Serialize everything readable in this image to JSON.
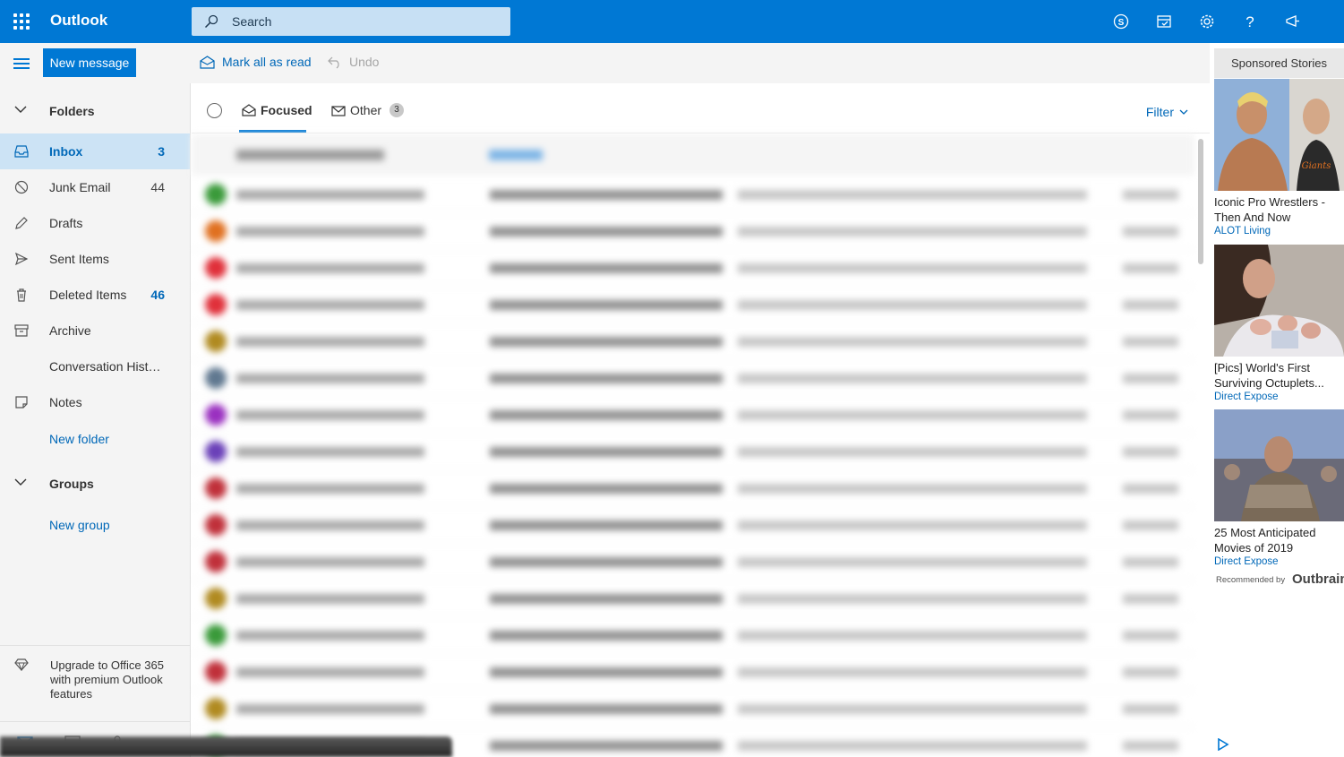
{
  "app": {
    "name": "Outlook"
  },
  "search": {
    "placeholder": "Search"
  },
  "toolbar": {
    "new_message": "New message",
    "mark_all_read": "Mark all as read",
    "undo": "Undo"
  },
  "folders": {
    "heading": "Folders",
    "items": [
      {
        "label": "Inbox",
        "count": "3",
        "icon": "inbox-icon",
        "active": true
      },
      {
        "label": "Junk Email",
        "count": "44",
        "icon": "junk-icon"
      },
      {
        "label": "Drafts",
        "count": "",
        "icon": "pencil-icon"
      },
      {
        "label": "Sent Items",
        "count": "",
        "icon": "send-icon"
      },
      {
        "label": "Deleted Items",
        "count": "46",
        "icon": "trash-icon"
      },
      {
        "label": "Archive",
        "count": "",
        "icon": "archive-icon"
      },
      {
        "label": "Conversation Hist…",
        "count": "",
        "icon": ""
      },
      {
        "label": "Notes",
        "count": "",
        "icon": "note-icon"
      }
    ],
    "new_folder": "New folder"
  },
  "groups": {
    "heading": "Groups",
    "new_group": "New group"
  },
  "upgrade": {
    "text": "Upgrade to Office 365 with premium Outlook features"
  },
  "tabs": {
    "focused": "Focused",
    "other": "Other",
    "other_count": "3",
    "filter": "Filter"
  },
  "message_rows": [
    {
      "avatar_color": "#3a9a3a"
    },
    {
      "avatar_color": "#e07020"
    },
    {
      "avatar_color": "#e0303a"
    },
    {
      "avatar_color": "#e0303a"
    },
    {
      "avatar_color": "#b08a20"
    },
    {
      "avatar_color": "#607890"
    },
    {
      "avatar_color": "#9a30c0"
    },
    {
      "avatar_color": "#6a40b8"
    },
    {
      "avatar_color": "#c0303a"
    },
    {
      "avatar_color": "#c0303a"
    },
    {
      "avatar_color": "#c0303a"
    },
    {
      "avatar_color": "#b08a20"
    },
    {
      "avatar_color": "#3a9a3a"
    },
    {
      "avatar_color": "#c0303a"
    },
    {
      "avatar_color": "#b08a20"
    },
    {
      "avatar_color": "#3a9a3a"
    }
  ],
  "ads": {
    "heading": "Sponsored Stories",
    "items": [
      {
        "title": "Iconic Pro Wrestlers - Then And Now",
        "source": "ALOT Living"
      },
      {
        "title": "[Pics] World's First Surviving Octuplets...",
        "source": "Direct Expose"
      },
      {
        "title": "25 Most Anticipated Movies of 2019",
        "source": "Direct Expose"
      }
    ],
    "recommended": "Recommended by",
    "brand": "Outbrain"
  },
  "colors": {
    "accent": "#0078d4",
    "link": "#0068b8",
    "selected_bg": "#cce3f5"
  }
}
